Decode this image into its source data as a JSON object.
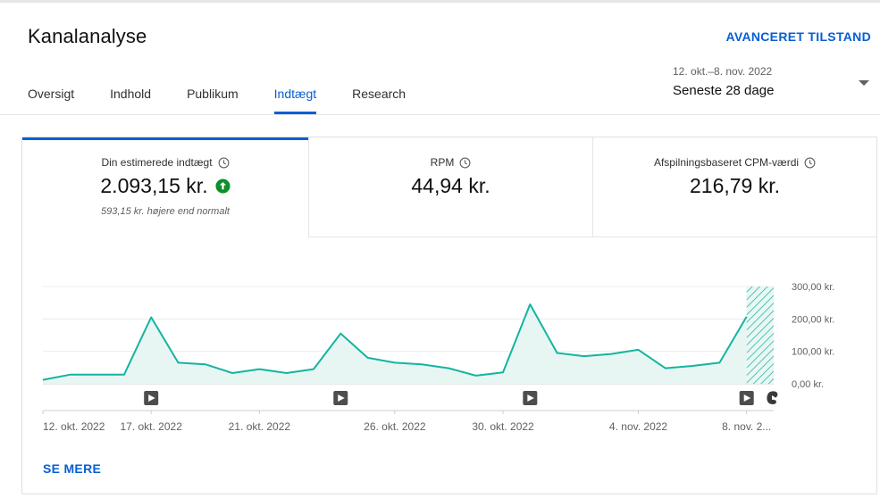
{
  "page": {
    "title": "Kanalanalyse",
    "advanced_mode": "AVANCERET TILSTAND"
  },
  "tabs": [
    {
      "label": "Oversigt",
      "active": false
    },
    {
      "label": "Indhold",
      "active": false
    },
    {
      "label": "Publikum",
      "active": false
    },
    {
      "label": "Indtægt",
      "active": true
    },
    {
      "label": "Research",
      "active": false
    }
  ],
  "date_range": {
    "range": "12. okt.–8. nov. 2022",
    "label": "Seneste 28 dage"
  },
  "metrics": [
    {
      "label": "Din estimerede indtægt",
      "value": "2.093,15 kr.",
      "note": "593,15 kr. højere end normalt",
      "trend": "up"
    },
    {
      "label": "RPM",
      "value": "44,94 kr."
    },
    {
      "label": "Afspilningsbaseret CPM-værdi",
      "value": "216,79 kr."
    }
  ],
  "colors": {
    "accent": "#065fd4",
    "line": "#12b5a0",
    "fill": "#e8f6f3",
    "trend_up": "#0d8f2b"
  },
  "icons": {
    "clock": "clock-icon",
    "up": "arrow-up-circle-icon",
    "video": "video-published-icon",
    "shorts": "shorts-icon",
    "dropdown": "caret-down-icon"
  },
  "chart_data": {
    "type": "area",
    "x": [
      "12. okt. 2022",
      "13. okt.",
      "14. okt.",
      "15. okt.",
      "16. okt.",
      "17. okt. 2022",
      "18. okt.",
      "19. okt.",
      "20. okt.",
      "21. okt. 2022",
      "22. okt.",
      "23. okt.",
      "24. okt.",
      "25. okt.",
      "26. okt. 2022",
      "27. okt.",
      "28. okt.",
      "29. okt.",
      "30. okt. 2022",
      "31. okt.",
      "1. nov.",
      "2. nov.",
      "3. nov.",
      "4. nov. 2022",
      "5. nov.",
      "6. nov.",
      "7. nov.",
      "8. nov. 2022"
    ],
    "values": [
      12,
      28,
      28,
      28,
      205,
      65,
      60,
      33,
      45,
      33,
      45,
      155,
      80,
      65,
      60,
      48,
      25,
      35,
      245,
      95,
      85,
      92,
      105,
      48,
      55,
      65,
      207
    ],
    "x_tick_labels": [
      {
        "index": 0,
        "label": "12. okt. 2022"
      },
      {
        "index": 4,
        "label": "17. okt. 2022"
      },
      {
        "index": 8,
        "label": "21. okt. 2022"
      },
      {
        "index": 13,
        "label": "26. okt. 2022"
      },
      {
        "index": 17,
        "label": "30. okt. 2022"
      },
      {
        "index": 22,
        "label": "4. nov. 2022"
      },
      {
        "index": 26,
        "label": "8. nov. 2..."
      }
    ],
    "y_ticks": [
      {
        "value": 300,
        "label": "300,00 kr."
      },
      {
        "value": 200,
        "label": "200,00 kr."
      },
      {
        "value": 100,
        "label": "100,00 kr."
      },
      {
        "value": 0,
        "label": "0,00 kr."
      }
    ],
    "ylim": [
      0,
      300
    ],
    "video_markers": [
      4,
      11,
      18,
      26
    ],
    "shorts_marker": 27,
    "incomplete_data_from_index": 26,
    "grid": true
  },
  "links": {
    "see_more": "SE MERE"
  }
}
